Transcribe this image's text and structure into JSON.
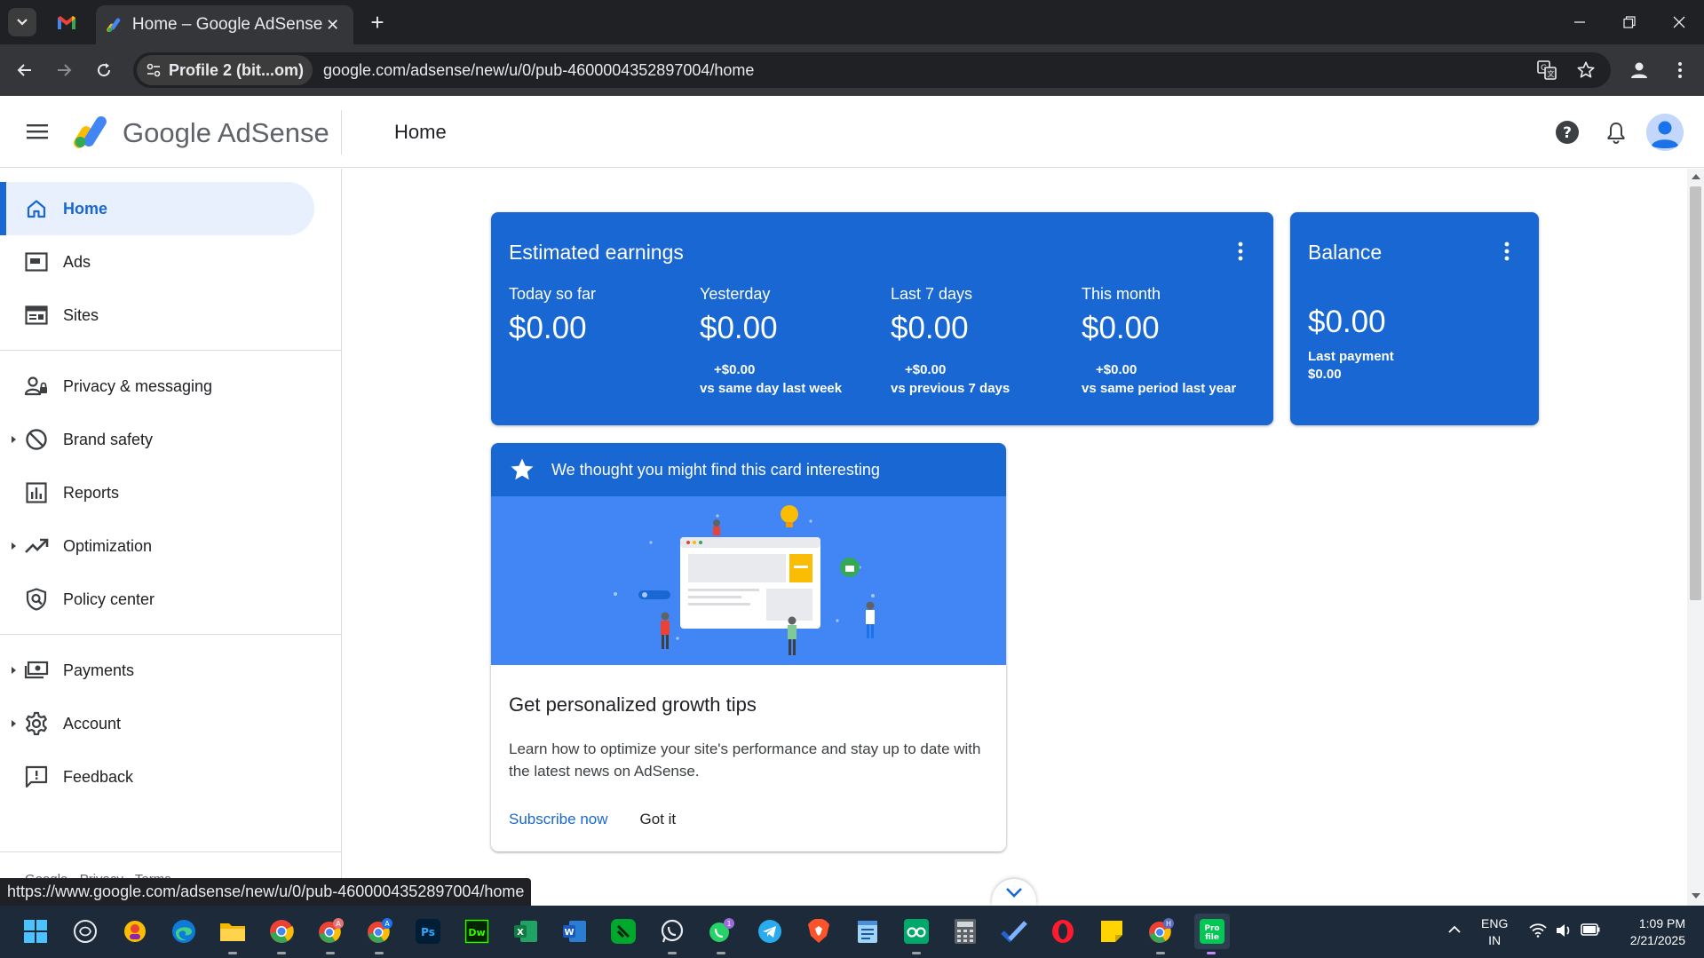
{
  "browser": {
    "active_tab_title": "Home – Google AdSense",
    "profile_label": "Profile 2 (bit...om)",
    "url": "google.com/adsense/new/u/0/pub-4600004352897004/home",
    "status_url": "https://www.google.com/adsense/new/u/0/pub-4600004352897004/home"
  },
  "header": {
    "product_name": "Google AdSense",
    "page_title": "Home"
  },
  "sidebar": {
    "items": [
      {
        "label": "Home",
        "icon": "home-icon",
        "active": true
      },
      {
        "label": "Ads",
        "icon": "ads-icon"
      },
      {
        "label": "Sites",
        "icon": "sites-icon"
      },
      {
        "label": "Privacy & messaging",
        "icon": "privacy-icon"
      },
      {
        "label": "Brand safety",
        "icon": "block-icon",
        "expandable": true
      },
      {
        "label": "Reports",
        "icon": "reports-icon"
      },
      {
        "label": "Optimization",
        "icon": "trending-icon",
        "expandable": true
      },
      {
        "label": "Policy center",
        "icon": "policy-icon"
      },
      {
        "label": "Payments",
        "icon": "payments-icon",
        "expandable": true
      },
      {
        "label": "Account",
        "icon": "gear-icon",
        "expandable": true
      },
      {
        "label": "Feedback",
        "icon": "feedback-icon"
      }
    ],
    "footer": "Google · Privacy · Terms"
  },
  "earnings": {
    "title": "Estimated earnings",
    "metrics": [
      {
        "label": "Today so far",
        "value": "$0.00",
        "delta": "",
        "comparison": ""
      },
      {
        "label": "Yesterday",
        "value": "$0.00",
        "delta": "+$0.00",
        "comparison": "vs same day last week"
      },
      {
        "label": "Last 7 days",
        "value": "$0.00",
        "delta": "+$0.00",
        "comparison": "vs previous 7 days"
      },
      {
        "label": "This month",
        "value": "$0.00",
        "delta": "+$0.00",
        "comparison": "vs same period last year"
      }
    ]
  },
  "balance": {
    "title": "Balance",
    "value": "$0.00",
    "last_payment_label": "Last payment",
    "last_payment_value": "$0.00"
  },
  "tips_card": {
    "header": "We thought you might find this card interesting",
    "title": "Get personalized growth tips",
    "body": "Learn how to optimize your site's performance and stay up to date with the latest news on AdSense.",
    "primary_action": "Subscribe now",
    "secondary_action": "Got it"
  },
  "taskbar": {
    "language": "ENG",
    "region": "IN",
    "time": "1:09 PM",
    "date": "2/21/2025",
    "apps": [
      "windows-start",
      "copilot",
      "canva",
      "edge",
      "file-explorer",
      "chrome",
      "chrome-profile-a",
      "chrome-profile-a2",
      "photoshop",
      "dreamweaver",
      "excel",
      "word",
      "evernote",
      "whatsapp",
      "whatsapp-business",
      "telegram",
      "brave",
      "notepad",
      "binoculars",
      "calculator",
      "todo",
      "opera",
      "sticky-notes",
      "chrome-profile-h",
      "profile-app"
    ],
    "badges": {
      "whatsapp-business": "1",
      "chrome-profile-a": "A",
      "chrome-profile-a2": "A",
      "chrome-profile-h": "H"
    }
  },
  "colors": {
    "brand_blue": "#1967d2",
    "illustration_blue": "#4285f4",
    "chrome_dark": "#202124",
    "taskbar": "#1c2a3a"
  }
}
